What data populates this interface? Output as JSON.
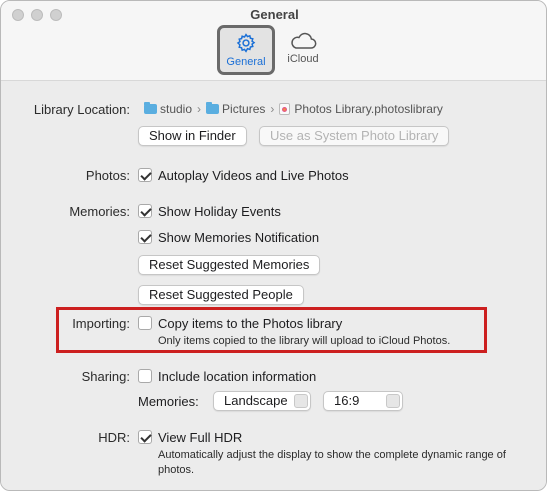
{
  "window": {
    "title": "General"
  },
  "tabs": [
    {
      "label": "General",
      "icon": "gear-icon",
      "active": true
    },
    {
      "label": "iCloud",
      "icon": "cloud-icon",
      "active": false
    }
  ],
  "library": {
    "label": "Library Location:",
    "path": [
      "studio",
      "Pictures",
      "Photos Library.photoslibrary"
    ],
    "show_in_finder": "Show in Finder",
    "use_as_system": "Use as System Photo Library"
  },
  "photos": {
    "label": "Photos:",
    "autoplay": {
      "label": "Autoplay Videos and Live Photos",
      "checked": true
    }
  },
  "memories": {
    "label": "Memories:",
    "holiday": {
      "label": "Show Holiday Events",
      "checked": true
    },
    "notification": {
      "label": "Show Memories Notification",
      "checked": true
    },
    "reset_memories": "Reset Suggested Memories",
    "reset_people": "Reset Suggested People"
  },
  "importing": {
    "label": "Importing:",
    "copy": {
      "label": "Copy items to the Photos library",
      "checked": false
    },
    "note": "Only items copied to the library will upload to iCloud Photos."
  },
  "sharing": {
    "label": "Sharing:",
    "location": {
      "label": "Include location information",
      "checked": false
    },
    "memories_label": "Memories:",
    "orientation": "Landscape",
    "aspect": "16:9"
  },
  "hdr": {
    "label": "HDR:",
    "view_full": {
      "label": "View Full HDR",
      "checked": true
    },
    "note": "Automatically adjust the display to show the complete dynamic range of photos."
  },
  "colors": {
    "accent": "#1a6fd6",
    "highlight_box": "#cc1f1f"
  }
}
